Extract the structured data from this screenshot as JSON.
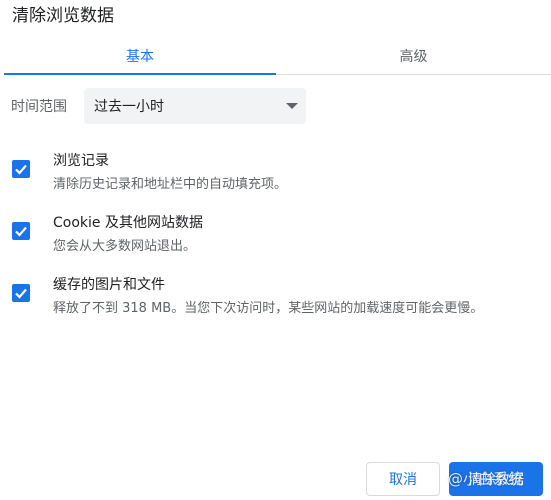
{
  "dialog": {
    "title": "清除浏览数据"
  },
  "tabs": [
    {
      "label": "基本",
      "active": true
    },
    {
      "label": "高级",
      "active": false
    }
  ],
  "time_range": {
    "label": "时间范围",
    "selected": "过去一小时"
  },
  "options": [
    {
      "title": "浏览记录",
      "description": "清除历史记录和地址栏中的自动填充项。",
      "checked": true
    },
    {
      "title": "Cookie 及其他网站数据",
      "description": "您会从大多数网站退出。",
      "checked": true
    },
    {
      "title": "缓存的图片和文件",
      "description": "释放了不到 318 MB。当您下次访问时，某些网站的加载速度可能会更慢。",
      "checked": true
    }
  ],
  "buttons": {
    "cancel": "取消",
    "clear": "清除数据"
  },
  "watermark": "@小白系统",
  "colors": {
    "accent": "#1a73e8",
    "secondary_text": "#5f6368"
  }
}
